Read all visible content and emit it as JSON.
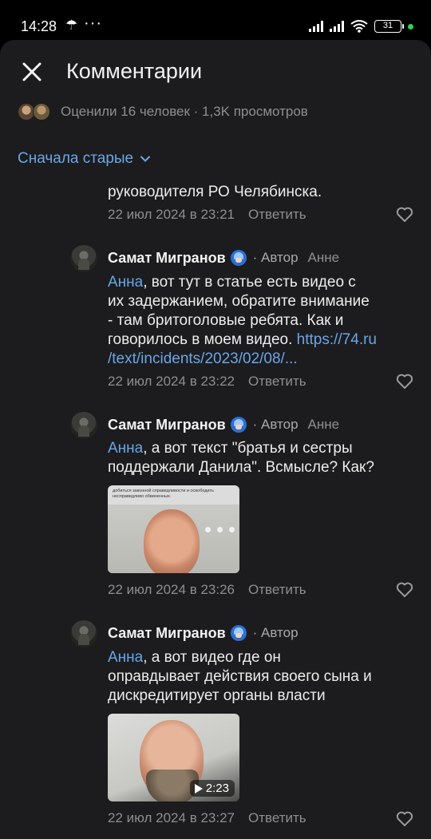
{
  "status_bar": {
    "time": "14:28",
    "battery": "31",
    "indicator_color": "#2ed15b"
  },
  "header": {
    "title": "Комментарии"
  },
  "stats": {
    "text": "Оценили 16 человек · 1,3K просмотров"
  },
  "sort": {
    "label": "Сначала старые"
  },
  "theme": {
    "background": "#1c1c1e",
    "accent": "#6aa6e8",
    "muted_text": "#8e8e93"
  },
  "comments": [
    {
      "text_tail": "руководителя РО Челябинска.",
      "date": "22 июл 2024 в 23:21",
      "reply_label": "Ответить"
    },
    {
      "author": "Самат Мигранов",
      "author_tag": "· Автор",
      "reply_to": "Анне",
      "mention": "Анна",
      "line1_rest": ", вот тут в статье есть видео с",
      "line2": "их задержанием, обратите внимание",
      "line3": "- там бритоголовые ребята. Как и",
      "line4_text": "говорилось в моем видео. ",
      "line4_link": "https://74.ru",
      "line5_link": "/text/incidents/2023/02/08/...",
      "date": "22 июл 2024 в 23:22",
      "reply_label": "Ответить"
    },
    {
      "author": "Самат Мигранов",
      "author_tag": "· Автор",
      "reply_to": "Анне",
      "mention": "Анна",
      "line1_rest": ", а вот текст \"братья и сестры",
      "line2": "поддержали Данила\". Всмысле? Как?",
      "image_caption": "добиться законной справедливости и освободить несправедливо обвиненных.",
      "date": "22 июл 2024 в 23:26",
      "reply_label": "Ответить"
    },
    {
      "author": "Самат Мигранов",
      "author_tag": "· Автор",
      "mention": "Анна",
      "line1_rest": ", а вот видео где он",
      "line2": "оправдывает действия своего сына и",
      "line3": "дискредитирует органы власти",
      "video_duration": "2:23",
      "date": "22 июл 2024 в 23:27",
      "reply_label": "Ответить"
    }
  ]
}
